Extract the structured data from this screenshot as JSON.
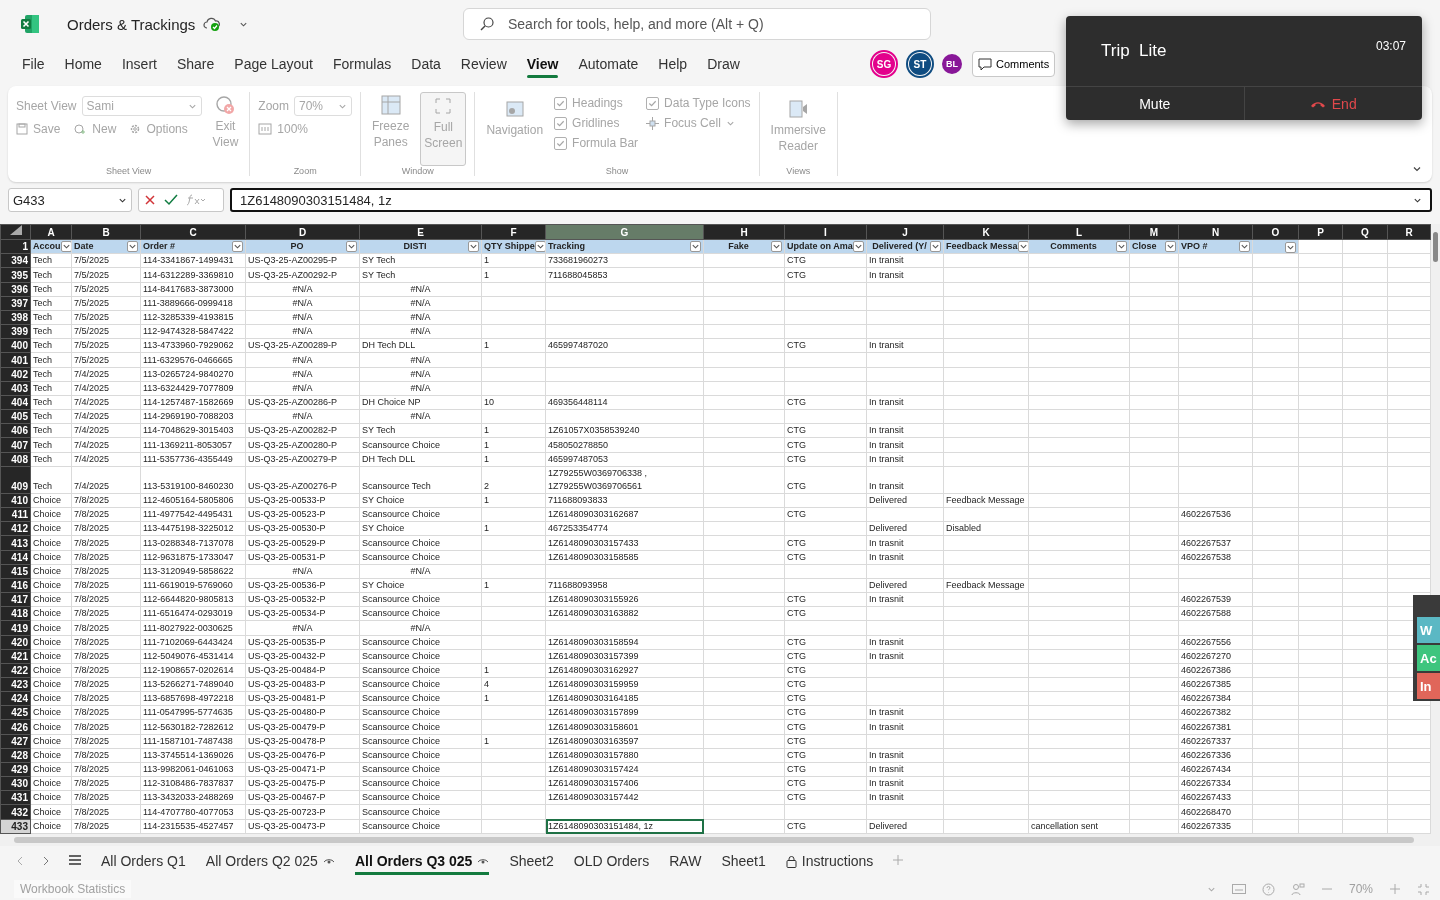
{
  "app": {
    "doc_title": "Orders & Trackings",
    "search_placeholder": "Search for tools, help, and more (Alt + Q)"
  },
  "menu_tabs": [
    {
      "label": "File",
      "selected": false
    },
    {
      "label": "Home",
      "selected": false
    },
    {
      "label": "Insert",
      "selected": false
    },
    {
      "label": "Share",
      "selected": false
    },
    {
      "label": "Page Layout",
      "selected": false
    },
    {
      "label": "Formulas",
      "selected": false
    },
    {
      "label": "Data",
      "selected": false
    },
    {
      "label": "Review",
      "selected": false
    },
    {
      "label": "View",
      "selected": true
    },
    {
      "label": "Automate",
      "selected": false
    },
    {
      "label": "Help",
      "selected": false
    },
    {
      "label": "Draw",
      "selected": false
    }
  ],
  "avatars": [
    {
      "initials": "SG",
      "color": "#e3008c"
    },
    {
      "initials": "ST",
      "color": "#0f4c81"
    },
    {
      "initials": "BL",
      "color": "#881798"
    }
  ],
  "comments_button": "Comments",
  "call": {
    "title": "Trip  Lite",
    "time": "03:07",
    "mute": "Mute",
    "end": "End"
  },
  "ribbon": {
    "disabled": true,
    "sheet_view": {
      "group": "Sheet View",
      "field_label": "Sheet View",
      "field_value": "Sami",
      "save": "Save",
      "new": "New",
      "options": "Options",
      "exit": "Exit\nView"
    },
    "zoom": {
      "group": "Zoom",
      "field_label": "Zoom",
      "field_value": "70%",
      "reset": "100%"
    },
    "window": {
      "group": "Window",
      "freeze": "Freeze\nPanes",
      "full": "Full\nScreen"
    },
    "show": {
      "group": "Show",
      "navigation": "Navigation",
      "checks": [
        {
          "label": "Headings",
          "checked": true
        },
        {
          "label": "Gridlines",
          "checked": true
        },
        {
          "label": "Formula Bar",
          "checked": true
        },
        {
          "label": "Data Type Icons",
          "checked": true
        }
      ],
      "focus": "Focus Cell"
    },
    "views": {
      "group": "Views",
      "immersive": "Immersive\nReader"
    }
  },
  "formula_bar": {
    "name_box": "G433",
    "formula": "1Z6148090303151484, 1z"
  },
  "sheet": {
    "columns": [
      {
        "letter": "A",
        "selected": false
      },
      {
        "letter": "B",
        "selected": false
      },
      {
        "letter": "C",
        "selected": false
      },
      {
        "letter": "D",
        "selected": false
      },
      {
        "letter": "E",
        "selected": false
      },
      {
        "letter": "F",
        "selected": false
      },
      {
        "letter": "G",
        "selected": true
      },
      {
        "letter": "H",
        "selected": false
      },
      {
        "letter": "I",
        "selected": false
      },
      {
        "letter": "J",
        "selected": false
      },
      {
        "letter": "K",
        "selected": false
      },
      {
        "letter": "L",
        "selected": false
      },
      {
        "letter": "M",
        "selected": false
      },
      {
        "letter": "N",
        "selected": false
      },
      {
        "letter": "O",
        "selected": false
      },
      {
        "letter": "P",
        "selected": false
      },
      {
        "letter": "Q",
        "selected": false
      },
      {
        "letter": "R",
        "selected": false
      }
    ],
    "header_row": "1",
    "headers": [
      {
        "label": "Accou",
        "filter": true
      },
      {
        "label": "Date",
        "filter": true
      },
      {
        "label": "Order #",
        "filter": true
      },
      {
        "label": "PO",
        "filter": true
      },
      {
        "label": "DISTI",
        "filter": true
      },
      {
        "label": "QTY Shippe",
        "filter": true
      },
      {
        "label": "Tracking",
        "filter": true
      },
      {
        "label": "Fake",
        "filter": true
      },
      {
        "label": "Update on Ama",
        "filter": true
      },
      {
        "label": "Delivered (Y/",
        "filter": true
      },
      {
        "label": "Feedback Messa",
        "filter": true
      },
      {
        "label": "Comments",
        "filter": true
      },
      {
        "label": "Close",
        "filter": true
      },
      {
        "label": "VPO #",
        "filter": true
      },
      {
        "filter": true
      }
    ],
    "rows": [
      {
        "n": "394",
        "selected": false,
        "na": false,
        "cells": [
          "Tech",
          "7/5/2025",
          "114-3341867-1499431",
          "US-Q3-25-AZ00295-P",
          "SY Tech",
          "1",
          "733681960273",
          null,
          "CTG",
          "In transit"
        ]
      },
      {
        "n": "395",
        "selected": false,
        "na": false,
        "cells": [
          "Tech",
          "7/5/2025",
          "114-6312289-3369810",
          "US-Q3-25-AZ00292-P",
          "SY Tech",
          "1",
          "711688045853",
          null,
          "CTG",
          "In transit"
        ]
      },
      {
        "n": "396",
        "selected": false,
        "na": true,
        "cells": [
          "Tech",
          "7/5/2025",
          "114-8417683-3873000",
          "#N/A",
          "#N/A"
        ]
      },
      {
        "n": "397",
        "selected": false,
        "na": true,
        "cells": [
          "Tech",
          "7/5/2025",
          "111-3889666-0999418",
          "#N/A",
          "#N/A"
        ]
      },
      {
        "n": "398",
        "selected": false,
        "na": true,
        "cells": [
          "Tech",
          "7/5/2025",
          "112-3285339-4193815",
          "#N/A",
          "#N/A"
        ]
      },
      {
        "n": "399",
        "selected": false,
        "na": true,
        "cells": [
          "Tech",
          "7/5/2025",
          "112-9474328-5847422",
          "#N/A",
          "#N/A"
        ]
      },
      {
        "n": "400",
        "selected": false,
        "na": false,
        "cells": [
          "Tech",
          "7/5/2025",
          "113-4733960-7929062",
          "US-Q3-25-AZ00289-P",
          "DH Tech DLL",
          "1",
          "465997487020",
          null,
          "CTG",
          "In transit"
        ]
      },
      {
        "n": "401",
        "selected": false,
        "na": true,
        "cells": [
          "Tech",
          "7/5/2025",
          "111-6329576-0466665",
          "#N/A",
          "#N/A"
        ]
      },
      {
        "n": "402",
        "selected": false,
        "na": true,
        "cells": [
          "Tech",
          "7/4/2025",
          "113-0265724-9840270",
          "#N/A",
          "#N/A"
        ]
      },
      {
        "n": "403",
        "selected": false,
        "na": true,
        "cells": [
          "Tech",
          "7/4/2025",
          "113-6324429-7077809",
          "#N/A",
          "#N/A"
        ]
      },
      {
        "n": "404",
        "selected": false,
        "na": false,
        "cells": [
          "Tech",
          "7/4/2025",
          "114-1257487-1582669",
          "US-Q3-25-AZ00286-P",
          "DH Choice NP",
          "10",
          "469356448114",
          null,
          "CTG",
          "In transit"
        ]
      },
      {
        "n": "405",
        "selected": false,
        "na": true,
        "cells": [
          "Tech",
          "7/4/2025",
          "114-2969190-7088203",
          "#N/A",
          "#N/A"
        ]
      },
      {
        "n": "406",
        "selected": false,
        "na": false,
        "cells": [
          "Tech",
          "7/4/2025",
          "114-7048629-3015403",
          "US-Q3-25-AZ00282-P",
          "SY Tech",
          "1",
          "1Z61057X0358539240",
          null,
          "CTG",
          "In transit"
        ]
      },
      {
        "n": "407",
        "selected": false,
        "na": false,
        "cells": [
          "Tech",
          "7/4/2025",
          "111-1369211-8053057",
          "US-Q3-25-AZ00280-P",
          "Scansource Choice",
          "1",
          "458050278850",
          null,
          "CTG",
          "In transit"
        ]
      },
      {
        "n": "408",
        "selected": false,
        "na": false,
        "cells": [
          "Tech",
          "7/4/2025",
          "111-5357736-4355449",
          "US-Q3-25-AZ00279-P",
          "DH Tech DLL",
          "1",
          "465997487053",
          null,
          "CTG",
          "In transit"
        ]
      },
      {
        "n": "409",
        "selected": false,
        "na": false,
        "cells": [
          "Tech",
          "7/4/2025",
          "113-5319100-8460230",
          "US-Q3-25-AZ00276-P",
          "Scansource Tech",
          "2",
          "1Z79255W0369706338 ,\n1Z79255W0369706561",
          null,
          "CTG",
          "In transit"
        ]
      },
      {
        "n": "410",
        "selected": false,
        "na": false,
        "cells": [
          "Choice",
          "7/8/2025",
          "112-4605164-5805806",
          "US-Q3-25-00533-P",
          "SY Choice",
          "1",
          "711688093833",
          null,
          null,
          "Delivered",
          "Feedback Message"
        ]
      },
      {
        "n": "411",
        "selected": false,
        "na": false,
        "cells": [
          "Choice",
          "7/8/2025",
          "111-4977542-4495431",
          "US-Q3-25-00523-P",
          "Scansource Choice",
          null,
          "1Z6148090303162687",
          null,
          "CTG",
          null,
          null,
          null,
          null,
          "4602267536"
        ]
      },
      {
        "n": "412",
        "selected": false,
        "na": false,
        "cells": [
          "Choice",
          "7/8/2025",
          "113-4475198-3225012",
          "US-Q3-25-00530-P",
          "SY Choice",
          "1",
          "467253354774",
          null,
          null,
          "Delivered",
          "Disabled"
        ]
      },
      {
        "n": "413",
        "selected": false,
        "na": false,
        "cells": [
          "Choice",
          "7/8/2025",
          "113-0288348-7137078",
          "US-Q3-25-00529-P",
          "Scansource Choice",
          null,
          "1Z6148090303157433",
          null,
          "CTG",
          "In trasnit",
          null,
          null,
          null,
          "4602267537"
        ]
      },
      {
        "n": "414",
        "selected": false,
        "na": false,
        "cells": [
          "Choice",
          "7/8/2025",
          "112-9631875-1733047",
          "US-Q3-25-00531-P",
          "Scansource Choice",
          null,
          "1Z6148090303158585",
          null,
          "CTG",
          "In trasnit",
          null,
          null,
          null,
          "4602267538"
        ]
      },
      {
        "n": "415",
        "selected": false,
        "na": true,
        "cells": [
          "Choice",
          "7/8/2025",
          "113-3120949-5858622",
          "#N/A",
          "#N/A"
        ]
      },
      {
        "n": "416",
        "selected": false,
        "na": false,
        "cells": [
          "Choice",
          "7/8/2025",
          "111-6619019-5769060",
          "US-Q3-25-00536-P",
          "SY Choice",
          "1",
          "711688093958",
          null,
          null,
          "Delivered",
          "Feedback Message"
        ]
      },
      {
        "n": "417",
        "selected": false,
        "na": false,
        "cells": [
          "Choice",
          "7/8/2025",
          "112-6644820-9805813",
          "US-Q3-25-00532-P",
          "Scansource Choice",
          null,
          "1Z6148090303155926",
          null,
          "CTG",
          "In trasnit",
          null,
          null,
          null,
          "4602267539"
        ]
      },
      {
        "n": "418",
        "selected": false,
        "na": false,
        "cells": [
          "Choice",
          "7/8/2025",
          "111-6516474-0293019",
          "US-Q3-25-00534-P",
          "Scansource Choice",
          null,
          "1Z6148090303163882",
          null,
          "CTG",
          null,
          null,
          null,
          null,
          "4602267588"
        ]
      },
      {
        "n": "419",
        "selected": false,
        "na": true,
        "cells": [
          "Choice",
          "7/8/2025",
          "111-8027922-0030625",
          "#N/A",
          "#N/A"
        ]
      },
      {
        "n": "420",
        "selected": false,
        "na": false,
        "cells": [
          "Choice",
          "7/8/2025",
          "111-7102069-6443424",
          "US-Q3-25-00535-P",
          "Scansource Choice",
          null,
          "1Z6148090303158594",
          null,
          "CTG",
          "In trasnit",
          null,
          null,
          null,
          "4602267556"
        ]
      },
      {
        "n": "421",
        "selected": false,
        "na": false,
        "cells": [
          "Choice",
          "7/8/2025",
          "112-5049076-4531414",
          "US-Q3-25-00432-P",
          "Scansource Choice",
          null,
          "1Z6148090303157399",
          null,
          "CTG",
          "In trasnit",
          null,
          null,
          null,
          "4602267270"
        ]
      },
      {
        "n": "422",
        "selected": false,
        "na": false,
        "cells": [
          "Choice",
          "7/8/2025",
          "112-1908657-0202614",
          "US-Q3-25-00484-P",
          "Scansource Choice",
          "1",
          "1Z6148090303162927",
          null,
          "CTG",
          null,
          null,
          null,
          null,
          "4602267386"
        ]
      },
      {
        "n": "423",
        "selected": false,
        "na": false,
        "cells": [
          "Choice",
          "7/8/2025",
          "113-5266271-7489040",
          "US-Q3-25-00483-P",
          "Scansource Choice",
          "4",
          "1Z6148090303159959",
          null,
          "CTG",
          null,
          null,
          null,
          null,
          "4602267385"
        ]
      },
      {
        "n": "424",
        "selected": false,
        "na": false,
        "cells": [
          "Choice",
          "7/8/2025",
          "113-6857698-4972218",
          "US-Q3-25-00481-P",
          "Scansource Choice",
          "1",
          "1Z6148090303164185",
          null,
          "CTG",
          null,
          null,
          null,
          null,
          "4602267384"
        ]
      },
      {
        "n": "425",
        "selected": false,
        "na": false,
        "cells": [
          "Choice",
          "7/8/2025",
          "111-0547995-5774635",
          "US-Q3-25-00480-P",
          "Scansource Choice",
          null,
          "1Z6148090303157899",
          null,
          "CTG",
          "In trasnit",
          null,
          null,
          null,
          "4602267382"
        ]
      },
      {
        "n": "426",
        "selected": false,
        "na": false,
        "cells": [
          "Choice",
          "7/8/2025",
          "112-5630182-7282612",
          "US-Q3-25-00479-P",
          "Scansource Choice",
          null,
          "1Z6148090303158601",
          null,
          "CTG",
          "In trasnit",
          null,
          null,
          null,
          "4602267381"
        ]
      },
      {
        "n": "427",
        "selected": false,
        "na": false,
        "cells": [
          "Choice",
          "7/8/2025",
          "111-1587101-7487438",
          "US-Q3-25-00478-P",
          "Scansource Choice",
          "1",
          "1Z6148090303163597",
          null,
          "CTG",
          null,
          null,
          null,
          null,
          "4602267337"
        ]
      },
      {
        "n": "428",
        "selected": false,
        "na": false,
        "cells": [
          "Choice",
          "7/8/2025",
          "113-3745514-1369026",
          "US-Q3-25-00476-P",
          "Scansource Choice",
          null,
          "1Z6148090303157880",
          null,
          "CTG",
          "In trasnit",
          null,
          null,
          null,
          "4602267336"
        ]
      },
      {
        "n": "429",
        "selected": false,
        "na": false,
        "cells": [
          "Choice",
          "7/8/2025",
          "113-9982061-0461063",
          "US-Q3-25-00471-P",
          "Scansource Choice",
          null,
          "1Z6148090303157424",
          null,
          "CTG",
          "In trasnit",
          null,
          null,
          null,
          "4602267434"
        ]
      },
      {
        "n": "430",
        "selected": false,
        "na": false,
        "cells": [
          "Choice",
          "7/8/2025",
          "112-3108486-7837837",
          "US-Q3-25-00475-P",
          "Scansource Choice",
          null,
          "1Z6148090303157406",
          null,
          "CTG",
          "In trasnit",
          null,
          null,
          null,
          "4602267334"
        ]
      },
      {
        "n": "431",
        "selected": false,
        "na": false,
        "cells": [
          "Choice",
          "7/8/2025",
          "113-3432033-2488269",
          "US-Q3-25-00467-P",
          "Scansource Choice",
          null,
          "1Z6148090303157442",
          null,
          "CTG",
          "In trasnit",
          null,
          null,
          null,
          "4602267433"
        ]
      },
      {
        "n": "432",
        "selected": false,
        "na": false,
        "cells": [
          "Choice",
          "7/8/2025",
          "114-4707780-4077053",
          "US-Q3-25-00723-P",
          "Scansource Choice",
          null,
          null,
          null,
          null,
          null,
          null,
          null,
          null,
          "4602268470"
        ]
      },
      {
        "n": "433",
        "selected": true,
        "na": false,
        "cells": [
          "Choice",
          "7/8/2025",
          "114-2315535-4527457",
          "US-Q3-25-00473-P",
          "Scansource Choice",
          null,
          "1Z6148090303151484, 1z",
          null,
          "CTG",
          "Delivered",
          null,
          "cancellation sent",
          null,
          "4602267335"
        ]
      }
    ],
    "side_widget": [
      {
        "label": "W",
        "color": "#5bb8c4"
      },
      {
        "label": "Ac",
        "color": "#3ec57e"
      },
      {
        "label": "In",
        "color": "#e0665a"
      }
    ]
  },
  "sheet_tabs": [
    {
      "label": "All Orders Q1",
      "selected": false,
      "kind": "plain"
    },
    {
      "label": "All Orders Q2 025",
      "selected": false,
      "kind": "watched"
    },
    {
      "label": "All Orders Q3 025",
      "selected": true,
      "kind": "watched"
    },
    {
      "label": "Sheet2",
      "selected": false,
      "kind": "plain"
    },
    {
      "label": "OLD Orders",
      "selected": false,
      "kind": "plain"
    },
    {
      "label": "RAW",
      "selected": false,
      "kind": "plain"
    },
    {
      "label": "Sheet1",
      "selected": false,
      "kind": "plain"
    },
    {
      "label": "Instructions",
      "selected": false,
      "kind": "locked"
    }
  ],
  "status_bar": {
    "left": "Workbook Statistics",
    "zoom": "70%"
  }
}
